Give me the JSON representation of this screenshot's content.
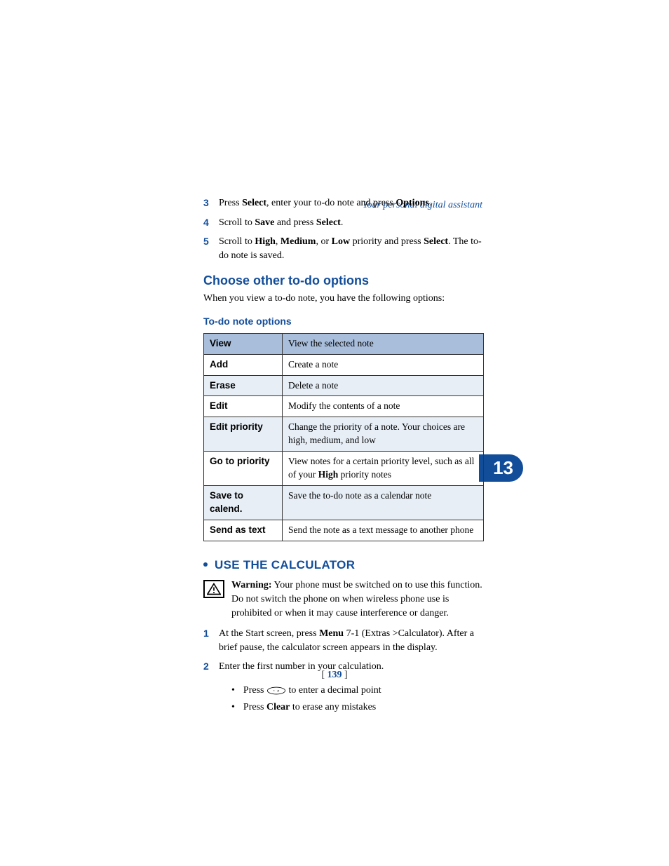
{
  "header": "Your personal digital assistant",
  "chapter_number": "13",
  "steps_top": [
    {
      "num": "3",
      "parts": [
        "Press ",
        {
          "b": "Select"
        },
        ", enter your to-do note and press ",
        {
          "b": "Options"
        },
        "."
      ]
    },
    {
      "num": "4",
      "parts": [
        "Scroll to ",
        {
          "b": "Save"
        },
        " and press ",
        {
          "b": "Select"
        },
        "."
      ]
    },
    {
      "num": "5",
      "parts": [
        "Scroll to ",
        {
          "b": "High"
        },
        ", ",
        {
          "b": "Medium"
        },
        ", or ",
        {
          "b": "Low"
        },
        " priority and press ",
        {
          "b": "Select"
        },
        ". The to-do note is saved."
      ]
    }
  ],
  "subheading": "Choose other to-do options",
  "sub_intro": "When you view a to-do note, you have the following options:",
  "table_title": "To-do note options",
  "table_rows": [
    {
      "left": "View",
      "right_parts": [
        "View the selected note"
      ],
      "header": true
    },
    {
      "left": "Add",
      "right_parts": [
        "Create a note"
      ]
    },
    {
      "left": "Erase",
      "right_parts": [
        "Delete a note"
      ],
      "alt": true
    },
    {
      "left": "Edit",
      "right_parts": [
        "Modify the contents of a note"
      ]
    },
    {
      "left": "Edit priority",
      "right_parts": [
        "Change the priority of a note. Your choices are high, medium, and low"
      ],
      "alt": true
    },
    {
      "left": "Go to priority",
      "right_parts": [
        "View notes for a certain priority level, such as all of your ",
        {
          "b": "High"
        },
        " priority notes"
      ]
    },
    {
      "left": "Save to calend.",
      "right_parts": [
        "Save the to-do note as a calendar note"
      ],
      "alt": true
    },
    {
      "left": "Send as text",
      "right_parts": [
        "Send the note as a text message to another phone"
      ]
    }
  ],
  "section_heading": "USE THE CALCULATOR",
  "warning": {
    "label": "Warning:",
    "text": " Your phone must be switched on to use this function. Do not switch the phone on when wireless phone use is prohibited or when it may cause interference or danger."
  },
  "steps_calc": [
    {
      "num": "1",
      "parts": [
        "At the Start screen, press ",
        {
          "b": "Menu"
        },
        " 7-1 (Extras >Calculator). After a brief pause, the calculator screen appears in the display."
      ]
    },
    {
      "num": "2",
      "parts": [
        "Enter the first number in your calculation."
      ]
    }
  ],
  "sub_bullets": [
    {
      "parts": [
        "Press ",
        {
          "icon": "key"
        },
        " to enter a decimal point"
      ]
    },
    {
      "parts": [
        "Press ",
        {
          "b": "Clear"
        },
        " to erase any mistakes"
      ]
    }
  ],
  "page_number": "139"
}
